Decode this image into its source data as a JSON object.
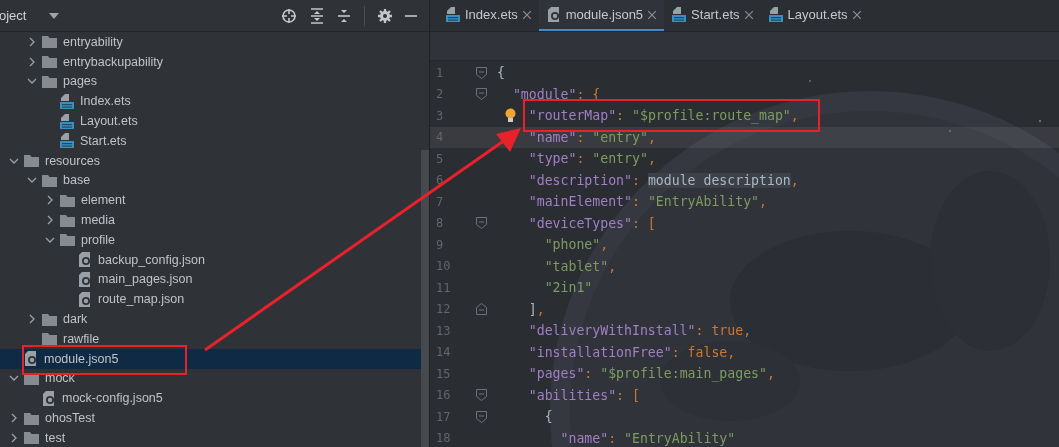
{
  "project_panel": {
    "title": "oject",
    "tree": [
      {
        "children": [
          {
            "children": [
              {
                "label": "entryability",
                "kind": "folder",
                "expanded": false,
                "selected": false
              },
              {
                "label": "entrybackupability",
                "kind": "folder",
                "expanded": false,
                "selected": false
              },
              {
                "label": "pages",
                "kind": "folder",
                "expanded": true,
                "selected": false,
                "children": [
                  {
                    "label": "Index.ets",
                    "kind": "ets",
                    "selected": false
                  },
                  {
                    "label": "Layout.ets",
                    "kind": "ets",
                    "selected": false
                  },
                  {
                    "label": "Start.ets",
                    "kind": "ets",
                    "selected": false
                  }
                ]
              }
            ]
          },
          {
            "label": "resources",
            "kind": "folder",
            "expanded": true,
            "selected": false,
            "children": [
              {
                "label": "base",
                "kind": "folder",
                "expanded": true,
                "selected": false,
                "children": [
                  {
                    "label": "element",
                    "kind": "folder",
                    "expanded": false,
                    "selected": false
                  },
                  {
                    "label": "media",
                    "kind": "folder",
                    "expanded": false,
                    "selected": false
                  },
                  {
                    "label": "profile",
                    "kind": "folder",
                    "expanded": true,
                    "selected": false,
                    "children": [
                      {
                        "label": "backup_config.json",
                        "kind": "json",
                        "selected": false
                      },
                      {
                        "label": "main_pages.json",
                        "kind": "json",
                        "selected": false
                      },
                      {
                        "label": "route_map.json",
                        "kind": "json",
                        "selected": false
                      }
                    ]
                  }
                ]
              },
              {
                "label": "dark",
                "kind": "folder",
                "expanded": false,
                "selected": false
              },
              {
                "label": "rawfile",
                "kind": "folder",
                "selected": false
              }
            ]
          },
          {
            "label": "module.json5",
            "kind": "json",
            "selected": true
          }
        ]
      },
      {
        "label": "mock",
        "kind": "folder",
        "expanded": true,
        "selected": false,
        "children": [
          {
            "label": "mock-config.json5",
            "kind": "json",
            "selected": false
          }
        ]
      },
      {
        "label": "ohosTest",
        "kind": "folder",
        "expanded": false,
        "selected": false
      },
      {
        "label": "test",
        "kind": "folder",
        "expanded": false,
        "selected": false
      }
    ]
  },
  "editor": {
    "tabs": [
      {
        "label": "Index.ets",
        "kind": "ets",
        "selected": false
      },
      {
        "label": "module.json5",
        "kind": "json",
        "selected": true
      },
      {
        "label": "Start.ets",
        "kind": "ets",
        "selected": false
      },
      {
        "label": "Layout.ets",
        "kind": "ets",
        "selected": false
      }
    ],
    "lines": [
      {
        "number": "1",
        "fold_open": true,
        "tokens": [
          {
            "kind": "brace",
            "text": "{"
          }
        ]
      },
      {
        "number": "2",
        "fold_open": true,
        "tokens": [
          {
            "kind": "key",
            "text": "  \"module\""
          },
          {
            "kind": "punct",
            "text": ": {"
          }
        ]
      },
      {
        "number": "3",
        "bulb": true,
        "tokens": [
          {
            "kind": "key",
            "text": "    \"routerMap\""
          },
          {
            "kind": "punct",
            "text": ": "
          },
          {
            "kind": "string",
            "text": "\"$profile:route_map\""
          },
          {
            "kind": "punct",
            "text": ","
          }
        ]
      },
      {
        "number": "4",
        "current": true,
        "tokens": [
          {
            "kind": "key",
            "text": "    \"name\""
          },
          {
            "kind": "punct",
            "text": ": "
          },
          {
            "kind": "string",
            "text": "\"entry\""
          },
          {
            "kind": "punct",
            "text": ","
          }
        ]
      },
      {
        "number": "5",
        "tokens": [
          {
            "kind": "key",
            "text": "    \"type\""
          },
          {
            "kind": "punct",
            "text": ": "
          },
          {
            "kind": "string",
            "text": "\"entry\""
          },
          {
            "kind": "punct",
            "text": ","
          }
        ]
      },
      {
        "number": "6",
        "tokens": [
          {
            "kind": "key",
            "text": "    \"description\""
          },
          {
            "kind": "punct",
            "text": ": "
          },
          {
            "kind": "unresolved",
            "text": "module description"
          },
          {
            "kind": "punct",
            "text": ","
          }
        ]
      },
      {
        "number": "7",
        "tokens": [
          {
            "kind": "key",
            "text": "    \"mainElement\""
          },
          {
            "kind": "punct",
            "text": ": "
          },
          {
            "kind": "string",
            "text": "\"EntryAbility\""
          },
          {
            "kind": "punct",
            "text": ","
          }
        ]
      },
      {
        "number": "8",
        "fold_open": true,
        "tokens": [
          {
            "kind": "key",
            "text": "    \"deviceTypes\""
          },
          {
            "kind": "punct",
            "text": ": ["
          }
        ]
      },
      {
        "number": "9",
        "tokens": [
          {
            "kind": "string",
            "text": "      \"phone\""
          },
          {
            "kind": "punct",
            "text": ","
          }
        ]
      },
      {
        "number": "10",
        "tokens": [
          {
            "kind": "string",
            "text": "      \"tablet\""
          },
          {
            "kind": "punct",
            "text": ","
          }
        ]
      },
      {
        "number": "11",
        "tokens": [
          {
            "kind": "string",
            "text": "      \"2in1\""
          }
        ]
      },
      {
        "number": "12",
        "fold_close": true,
        "tokens": [
          {
            "kind": "brace",
            "text": "    ]"
          },
          {
            "kind": "punct",
            "text": ","
          }
        ]
      },
      {
        "number": "13",
        "tokens": [
          {
            "kind": "key",
            "text": "    \"deliveryWithInstall\""
          },
          {
            "kind": "punct",
            "text": ": "
          },
          {
            "kind": "literal",
            "text": "true"
          },
          {
            "kind": "punct",
            "text": ","
          }
        ]
      },
      {
        "number": "14",
        "tokens": [
          {
            "kind": "key",
            "text": "    \"installationFree\""
          },
          {
            "kind": "punct",
            "text": ": "
          },
          {
            "kind": "literal",
            "text": "false"
          },
          {
            "kind": "punct",
            "text": ","
          }
        ]
      },
      {
        "number": "15",
        "tokens": [
          {
            "kind": "key",
            "text": "    \"pages\""
          },
          {
            "kind": "punct",
            "text": ": "
          },
          {
            "kind": "string",
            "text": "\"$profile:main_pages\""
          },
          {
            "kind": "punct",
            "text": ","
          }
        ]
      },
      {
        "number": "16",
        "fold_open": true,
        "tokens": [
          {
            "kind": "key",
            "text": "    \"abilities\""
          },
          {
            "kind": "punct",
            "text": ": ["
          }
        ]
      },
      {
        "number": "17",
        "fold_open": true,
        "tokens": [
          {
            "kind": "brace",
            "text": "      {"
          }
        ]
      },
      {
        "number": "18",
        "tokens": [
          {
            "kind": "key",
            "text": "        \"name\""
          },
          {
            "kind": "punct",
            "text": ": "
          },
          {
            "kind": "string",
            "text": "\"EntryAbility\""
          }
        ]
      }
    ]
  }
}
